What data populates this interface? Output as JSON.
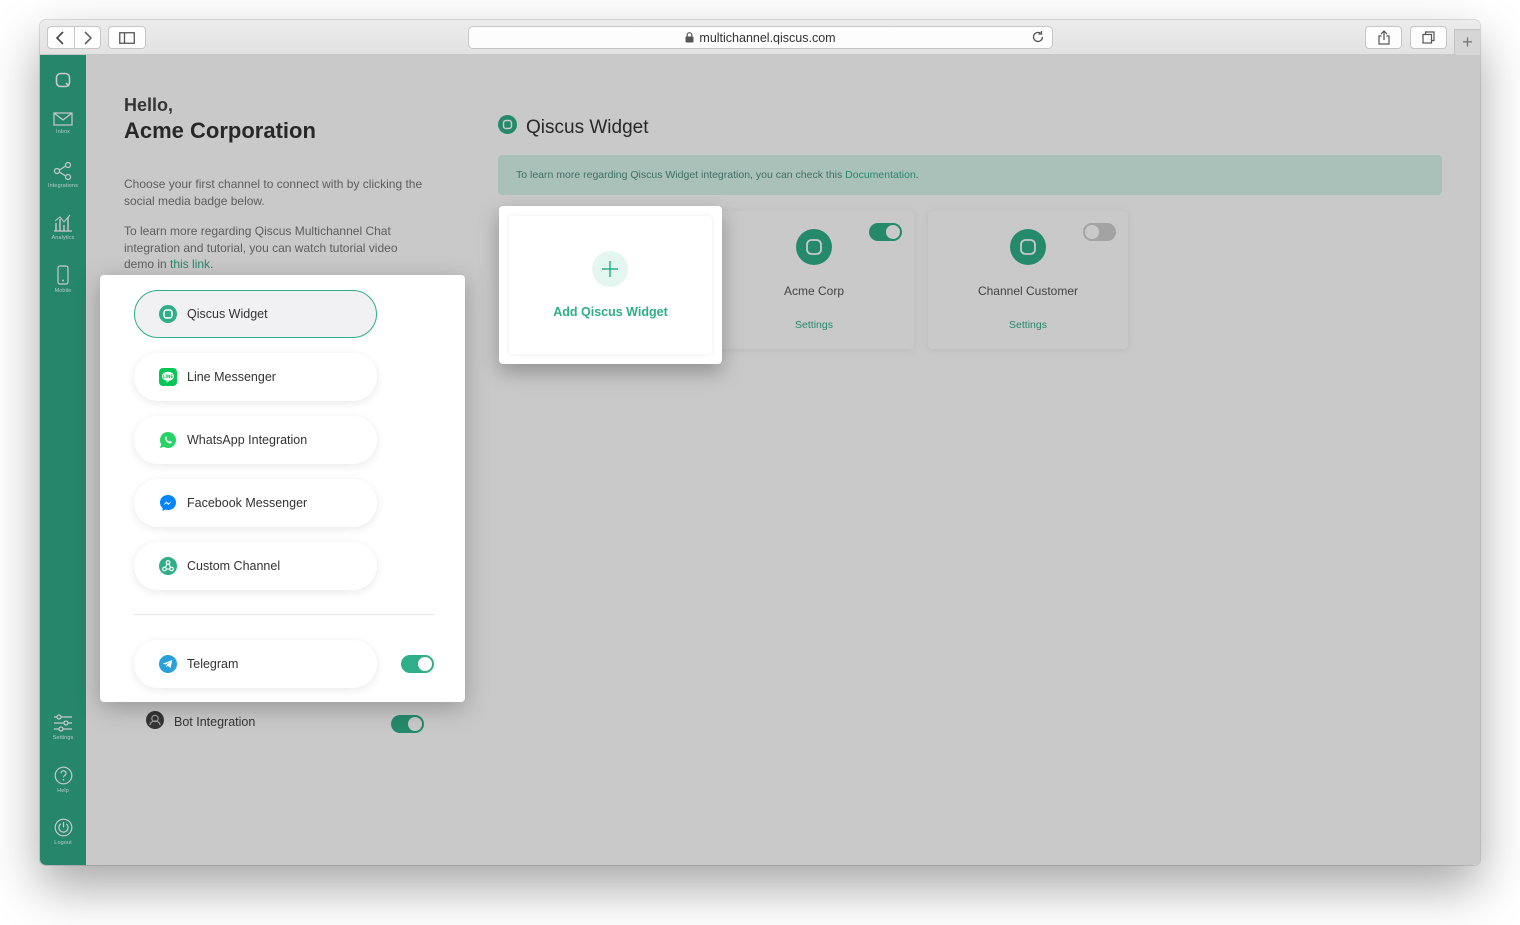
{
  "browser": {
    "url": "multichannel.qiscus.com",
    "new_tab": "+"
  },
  "sidebar": {
    "items": [
      {
        "label": "",
        "icon": "qiscus-logo-icon"
      },
      {
        "label": "Inbox",
        "icon": "inbox-icon"
      },
      {
        "label": "Integrations",
        "icon": "integrations-icon"
      },
      {
        "label": "Analytics",
        "icon": "analytics-icon"
      },
      {
        "label": "Mobile",
        "icon": "mobile-icon"
      },
      {
        "label": "Settings",
        "icon": "settings-icon"
      },
      {
        "label": "Help",
        "icon": "help-icon"
      },
      {
        "label": "Logout",
        "icon": "logout-icon"
      }
    ]
  },
  "intro": {
    "hello": "Hello,",
    "company": "Acme Corporation",
    "paragraph1": "Choose your first channel to connect with by clicking the social media badge below.",
    "paragraph2": "To learn more regarding Qiscus Multichannel Chat integration and tutorial, you can watch tutorial video demo in",
    "link": "this link",
    "link_suffix": "."
  },
  "section": {
    "title": "Qiscus Widget",
    "notice_text": "To learn more regarding Qiscus Widget integration, you can check this",
    "notice_link": "Documentation",
    "notice_suffix": "."
  },
  "cards": [
    {
      "name": "Acme Corp",
      "settings": "Settings",
      "enabled": true
    },
    {
      "name": "Channel Customer",
      "settings": "Settings",
      "enabled": false
    }
  ],
  "add_widget": {
    "label": "Add Qiscus Widget",
    "icon": "plus-icon"
  },
  "channels": [
    {
      "label": "Qiscus Widget",
      "icon": "qiscus-icon",
      "active": true
    },
    {
      "label": "Line Messenger",
      "icon": "line-icon",
      "active": false
    },
    {
      "label": "WhatsApp Integration",
      "icon": "whatsapp-icon",
      "active": false
    },
    {
      "label": "Facebook Messenger",
      "icon": "messenger-icon",
      "active": false
    },
    {
      "label": "Custom Channel",
      "icon": "custom-channel-icon",
      "active": false
    }
  ],
  "telegram": {
    "label": "Telegram",
    "enabled": true
  },
  "bot": {
    "label": "Bot Integration",
    "enabled": true
  },
  "colors": {
    "accent": "#2fae88",
    "line": "#06c755",
    "whatsapp": "#25d366",
    "messenger": "#0084ff",
    "telegram": "#2aa0da"
  }
}
